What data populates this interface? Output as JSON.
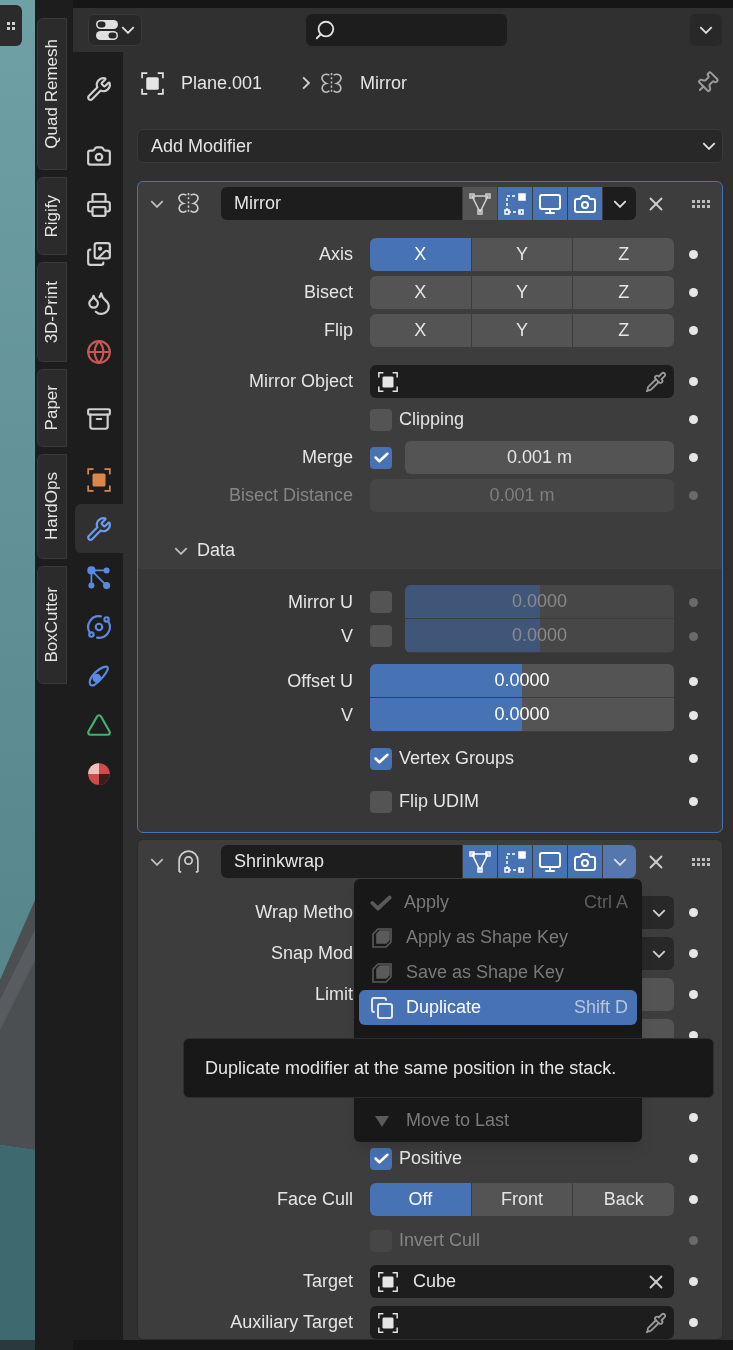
{
  "sidebar_tabs": [
    {
      "label": "Quad Remesh"
    },
    {
      "label": "Rigify"
    },
    {
      "label": "3D-Print"
    },
    {
      "label": "Paper"
    },
    {
      "label": "HardOps"
    },
    {
      "label": "BoxCutter"
    }
  ],
  "property_tab_groups": [
    {
      "tabs": [
        {
          "kind": "tool",
          "selected": false
        }
      ]
    },
    {
      "tabs": [
        {
          "kind": "render",
          "selected": false
        },
        {
          "kind": "output",
          "selected": false
        },
        {
          "kind": "view_layer",
          "selected": false
        },
        {
          "kind": "scene",
          "selected": false
        },
        {
          "kind": "world",
          "selected": false
        }
      ]
    },
    {
      "tabs": [
        {
          "kind": "collection",
          "selected": false
        }
      ]
    },
    {
      "tabs": [
        {
          "kind": "object",
          "selected": false
        },
        {
          "kind": "modifier",
          "selected": true
        },
        {
          "kind": "particles",
          "selected": false
        },
        {
          "kind": "physics",
          "selected": false
        },
        {
          "kind": "constraints",
          "selected": false
        },
        {
          "kind": "data",
          "selected": false
        },
        {
          "kind": "material",
          "selected": false
        }
      ]
    }
  ],
  "breadcrumb": {
    "object": "Plane.001",
    "modifier": {
      "kind": "mirror",
      "name": "Mirror"
    }
  },
  "add_modifier": "Add Modifier",
  "modifiers": [
    {
      "kind": "mirror",
      "name": "Mirror",
      "active": true,
      "expanded": true,
      "menu_open": false,
      "toggles": [
        {
          "kind": "edit_mode",
          "on": false
        },
        {
          "kind": "on_cage",
          "on": true
        },
        {
          "kind": "viewport",
          "on": true
        },
        {
          "kind": "render",
          "on": true
        }
      ],
      "rows": [
        {
          "kind": "segmented",
          "label": "Axis",
          "options": [
            {
              "label": "X",
              "selected": true
            },
            {
              "label": "Y",
              "selected": false
            },
            {
              "label": "Z",
              "selected": false
            }
          ]
        },
        {
          "kind": "segmented",
          "label": "Bisect",
          "options": [
            {
              "label": "X",
              "selected": false
            },
            {
              "label": "Y",
              "selected": false
            },
            {
              "label": "Z",
              "selected": false
            }
          ]
        },
        {
          "kind": "segmented",
          "label": "Flip",
          "options": [
            {
              "label": "X",
              "selected": false
            },
            {
              "label": "Y",
              "selected": false
            },
            {
              "label": "Z",
              "selected": false
            }
          ]
        },
        {
          "kind": "object",
          "label": "Mirror Object"
        },
        {
          "kind": "checkbox",
          "label": "Clipping",
          "checked": false,
          "disabled": false
        },
        {
          "kind": "check_number",
          "label": "Merge",
          "checked": true,
          "value": "0.001 m"
        },
        {
          "kind": "number",
          "label": "Bisect Distance",
          "value": "0.001 m",
          "disabled": true
        },
        {
          "kind": "subpanel",
          "label": "Data",
          "expanded": true,
          "rows": [
            {
              "kind": "check_slider_pair",
              "disabled": true,
              "items": [
                {
                  "label": "Mirror U",
                  "checked": false,
                  "value": "0.0000",
                  "level": 0.5
                },
                {
                  "label": "V",
                  "checked": false,
                  "value": "0.0000",
                  "level": 0.5
                }
              ]
            },
            {
              "kind": "slider_pair",
              "disabled": false,
              "items": [
                {
                  "label": "Offset U",
                  "value": "0.0000",
                  "level": 0.5
                },
                {
                  "label": "V",
                  "value": "0.0000",
                  "level": 0.5
                }
              ]
            },
            {
              "kind": "checkbox",
              "label": "Vertex Groups",
              "checked": true,
              "disabled": false
            },
            {
              "kind": "checkbox",
              "label": "Flip UDIM",
              "checked": false,
              "disabled": false
            }
          ]
        }
      ]
    },
    {
      "kind": "shrinkwrap",
      "name": "Shrinkwrap",
      "active": false,
      "expanded": true,
      "menu_open": true,
      "toggles": [
        {
          "kind": "edit_mode",
          "on": true
        },
        {
          "kind": "on_cage",
          "on": true
        },
        {
          "kind": "viewport",
          "on": true
        },
        {
          "kind": "render",
          "on": true
        }
      ],
      "menu": {
        "items": [
          {
            "kind": "check",
            "label": "Apply",
            "shortcut": "Ctrl A",
            "disabled": true,
            "selected": false
          },
          {
            "kind": "shape_key",
            "label": "Apply as Shape Key",
            "disabled": true,
            "selected": false
          },
          {
            "kind": "shape_key",
            "label": "Save as Shape Key",
            "disabled": true,
            "selected": false
          },
          {
            "kind": "duplicate",
            "label": "Duplicate",
            "shortcut": "Shift D",
            "disabled": false,
            "selected": true
          },
          {
            "kind": "move_last",
            "label": "Move to Last",
            "disabled": true,
            "selected": false
          }
        ]
      },
      "rows": [
        {
          "kind": "dropdown",
          "label": "Wrap Metho"
        },
        {
          "kind": "dropdown",
          "label": "Snap Mod"
        },
        {
          "kind": "number",
          "label": "Limit",
          "disabled": false
        },
        {
          "kind": "number",
          "disabled": false
        },
        {
          "kind": "covered"
        },
        {
          "kind": "checkbox",
          "label": "Positive",
          "checked": true,
          "disabled": false
        },
        {
          "kind": "segmented",
          "label": "Face Cull",
          "options": [
            {
              "label": "Off",
              "selected": true
            },
            {
              "label": "Front",
              "selected": false
            },
            {
              "label": "Back",
              "selected": false
            }
          ]
        },
        {
          "kind": "checkbox",
          "label": "Invert Cull",
          "checked": false,
          "disabled": true
        },
        {
          "kind": "object",
          "label": "Target",
          "value": "Cube"
        },
        {
          "kind": "object",
          "label": "Auxiliary Target"
        }
      ]
    }
  ],
  "tooltip": {
    "text": "Duplicate modifier at the same position in the stack."
  }
}
